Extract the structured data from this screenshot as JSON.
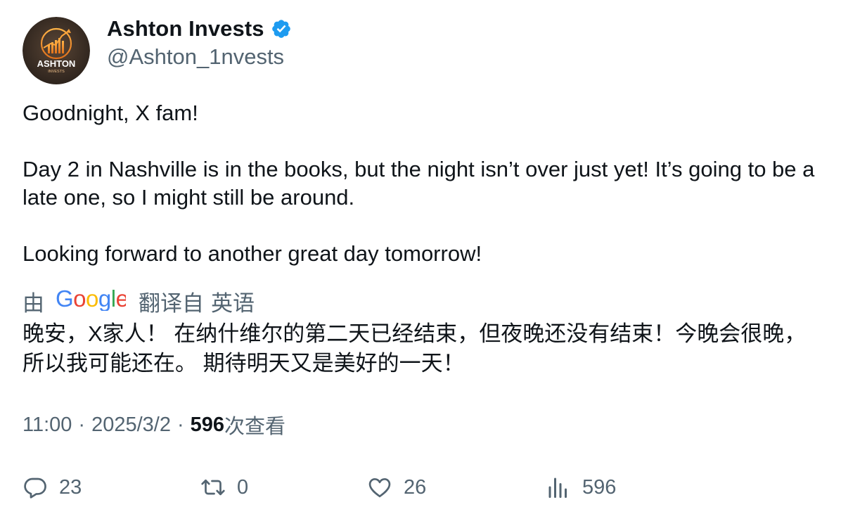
{
  "author": {
    "display_name": "Ashton Invests",
    "handle": "@Ashton_1nvests",
    "avatar_text_main": "ASHTON",
    "avatar_text_sub": "INVESTS",
    "verified": true
  },
  "tweet": {
    "paragraphs": [
      "Goodnight, X fam!",
      "Day 2 in Nashville is in the books, but the night isn’t over just yet! It’s going to be a late one, so I might still be around.",
      "Looking forward to another great day tomorrow!"
    ]
  },
  "translation": {
    "by_label": "由",
    "provider": "Google",
    "translated_from": "翻译自",
    "language": "英语",
    "text": "晚安，X家人！ 在纳什维尔的第二天已经结束，但夜晚还没有结束！今晚会很晚，所以我可能还在。 期待明天又是美好的一天！"
  },
  "meta": {
    "time": "11:00",
    "separator": "·",
    "date": "2025/3/2",
    "views_count": "596",
    "views_label": "次查看"
  },
  "actions": {
    "replies": "23",
    "retweets": "0",
    "likes": "26",
    "views": "596"
  },
  "colors": {
    "text": "#0f1419",
    "secondary": "#536471",
    "verified_blue": "#1d9bf0"
  },
  "icons": [
    "reply-icon",
    "retweet-icon",
    "like-icon",
    "views-icon",
    "verified-badge-icon"
  ]
}
